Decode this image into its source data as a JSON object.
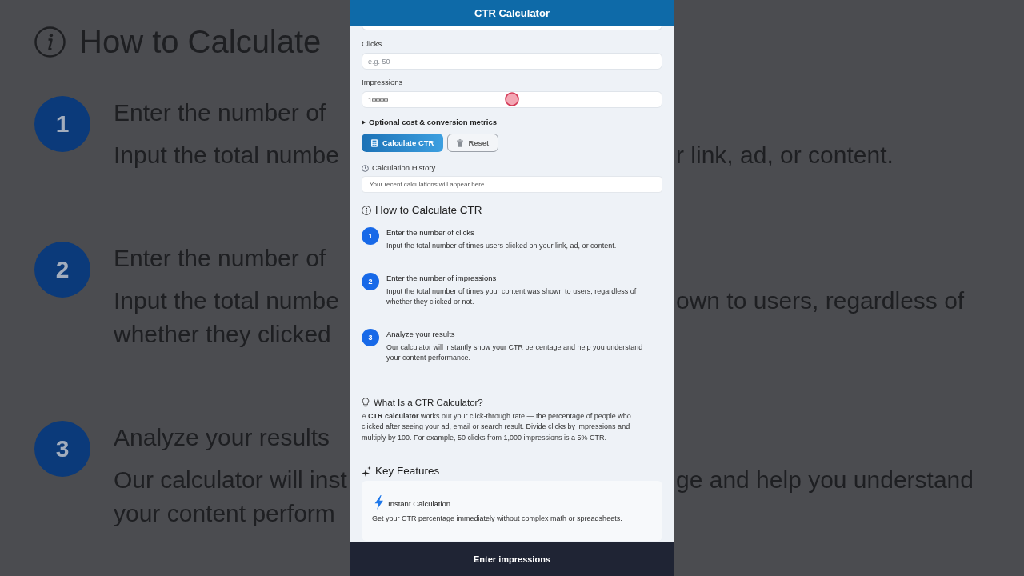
{
  "header": {
    "title": "CTR Calculator"
  },
  "fields": [
    {
      "label": "Clicks",
      "placeholder": "e.g. 50"
    },
    {
      "label": "Impressions",
      "value": "10000",
      "tapped": true
    }
  ],
  "options": {
    "label": "Optional cost & conversion metrics",
    "expanded": false
  },
  "buttons": [
    {
      "label": "Calculate CTR",
      "kind": "primary"
    },
    {
      "label": "Reset",
      "kind": "secondary"
    }
  ],
  "history": {
    "title": "Calculation History",
    "empty_text": "Your recent calculations will appear here."
  },
  "how_to": {
    "title": "How to Calculate CTR",
    "steps": [
      {
        "number": "1",
        "title": "Enter the number of clicks",
        "text": "Input the total number of times users clicked on your link, ad, or content."
      },
      {
        "number": "2",
        "title": "Enter the number of impressions",
        "text": "Input the total number of times your content was shown to users, regardless of whether they clicked or not."
      },
      {
        "number": "3",
        "title": "Analyze your results",
        "text": "Our calculator will instantly show your CTR percentage and help you understand your content performance."
      }
    ]
  },
  "about": {
    "title": "What Is a CTR Calculator?",
    "text": "A **CTR calculator** works out your click-through rate — the percentage of people who clicked after seeing your ad, email or search result. Divide clicks by impressions and multiply by 100. For example, 50 clicks from 1,000 impressions is a 5% CTR."
  },
  "features": {
    "title": "Key Features",
    "items": [
      {
        "title": "Instant Calculation",
        "text": "Get your CTR percentage immediately without complex math or spreadsheets."
      }
    ]
  },
  "caption": "Enter impressions",
  "backdrop": {
    "heading": "How to Calculate",
    "steps": [
      {
        "number": "1",
        "title": "Enter the number of",
        "lines": [
          "Input the total numbe"
        ],
        "right_text": "r link, ad, or content."
      },
      {
        "number": "2",
        "title": "Enter the number of",
        "lines": [
          "Input the total numbe",
          "whether they clicked"
        ],
        "right_text": "own to users, regardless of"
      },
      {
        "number": "3",
        "title": "Analyze your results",
        "lines": [
          "Our calculator will inst",
          "your content perform"
        ],
        "right_text": "ge and help you understand"
      }
    ]
  }
}
